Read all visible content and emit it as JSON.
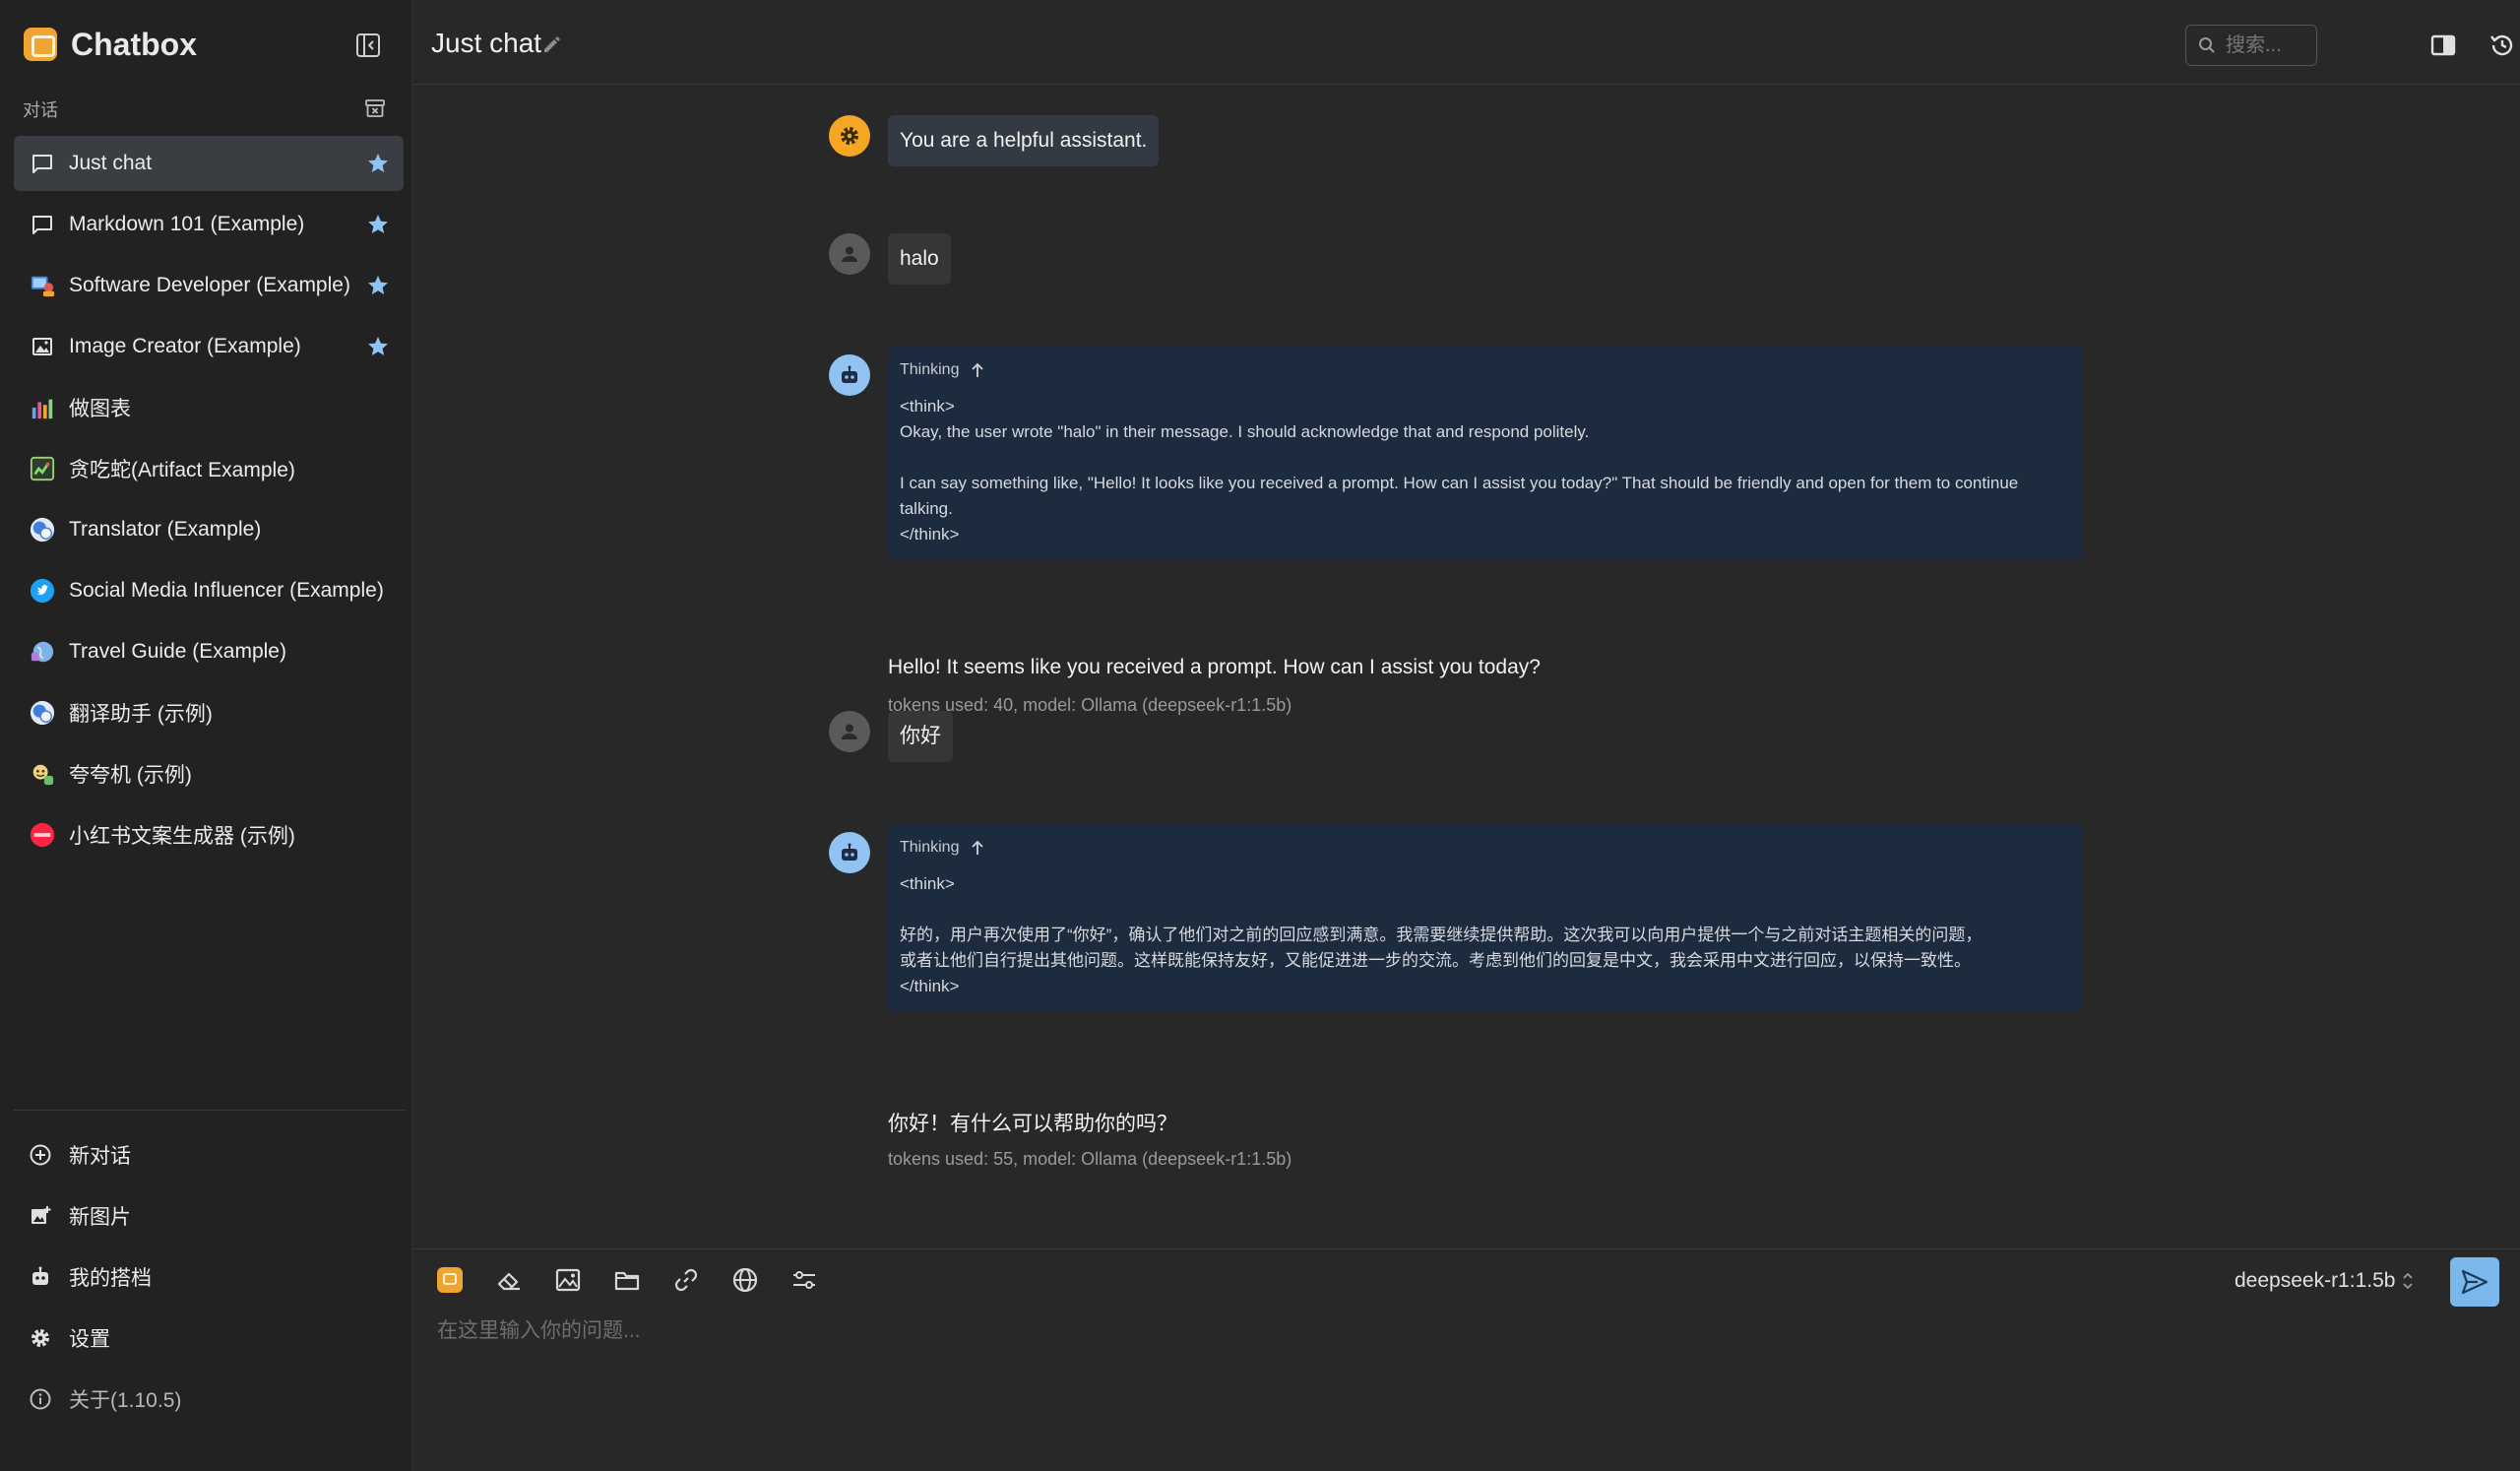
{
  "app": {
    "name": "Chatbox"
  },
  "sidebar": {
    "section_label": "对话",
    "conversations": [
      {
        "label": "Just chat",
        "starred": true,
        "active": true,
        "icon": "chat-bubble-icon"
      },
      {
        "label": "Markdown 101 (Example)",
        "starred": true,
        "icon": "chat-bubble-icon"
      },
      {
        "label": "Software Developer (Example)",
        "starred": true,
        "icon": "developer-avatar-icon"
      },
      {
        "label": "Image Creator (Example)",
        "starred": true,
        "icon": "image-icon"
      },
      {
        "label": "做图表",
        "icon": "chart-avatar-icon"
      },
      {
        "label": "贪吃蛇(Artifact Example)",
        "icon": "snake-game-avatar-icon"
      },
      {
        "label": "Translator (Example)",
        "icon": "translator-avatar-icon"
      },
      {
        "label": "Social Media Influencer (Example)",
        "icon": "twitter-bird-icon"
      },
      {
        "label": "Travel Guide (Example)",
        "icon": "globe-avatar-icon"
      },
      {
        "label": "翻译助手 (示例)",
        "icon": "translator-avatar-icon"
      },
      {
        "label": "夸夸机 (示例)",
        "icon": "praise-avatar-icon"
      },
      {
        "label": "小红书文案生成器 (示例)",
        "icon": "xiaohongshu-avatar-icon"
      }
    ],
    "bottom_menu": {
      "new_chat": "新对话",
      "new_image": "新图片",
      "my_copilots": "我的搭档",
      "settings": "设置",
      "about": "关于(1.10.5)"
    }
  },
  "header": {
    "title": "Just chat",
    "search_placeholder": "搜索..."
  },
  "messages": {
    "system": {
      "text": "You are a helpful assistant."
    },
    "user1": {
      "text": "halo"
    },
    "assistant1": {
      "thinking_label": "Thinking",
      "thinking_text": "<think>\nOkay, the user wrote \"halo\" in their message. I should acknowledge that and respond politely.\n\nI can say something like, \"Hello! It looks like you received a prompt. How can I assist you today?\" That should be friendly and open for them to continue talking.\n</think>",
      "reply": "Hello! It seems like you received a prompt. How can I assist you today?",
      "meta": "tokens used: 40, model: Ollama (deepseek-r1:1.5b)"
    },
    "user2": {
      "text": "你好"
    },
    "assistant2": {
      "thinking_label": "Thinking",
      "thinking_text": "<think>\n\n好的，用户再次使用了“你好”，确认了他们对之前的回应感到满意。我需要继续提供帮助。这次我可以向用户提供一个与之前对话主题相关的问题，\n或者让他们自行提出其他问题。这样既能保持友好，又能促进进一步的交流。考虑到他们的回复是中文，我会采用中文进行回应，以保持一致性。\n</think>",
      "reply": "你好！有什么可以帮助你的吗？",
      "meta": "tokens used: 55, model: Ollama (deepseek-r1:1.5b)"
    }
  },
  "composer": {
    "placeholder": "在这里输入你的问题...",
    "model": "deepseek-r1:1.5b"
  },
  "colors": {
    "accent": "#7ab8ec",
    "star": "#8ec3f5",
    "system_avatar": "#f5a623",
    "bot_avatar": "#90c2f2",
    "thinking_bg": "#1d2b3f"
  }
}
